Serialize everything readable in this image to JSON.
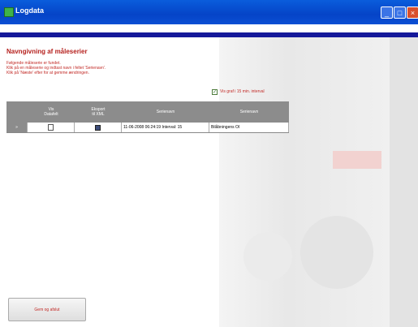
{
  "window": {
    "title": "Logdata"
  },
  "page": {
    "heading": "Navngivning af måleserier",
    "instructions": [
      "Følgende måleserie er fundet.",
      "Klik på en måleserie og indtast navn i feltet 'Serienavn'.",
      "Klik på 'Næste' efter for at gemme ændringen."
    ],
    "interval_checkbox": {
      "label": "Vis graf i 15 min. interval",
      "checked": true
    }
  },
  "grid": {
    "columns": [
      "Vis\nDatafelt",
      "Eksport\ntil XML",
      "Serienavn",
      "Serienavn"
    ],
    "rows": [
      {
        "row_marker": "»",
        "name": "11-06-2008 06:24:19 Interval: 15",
        "series": "Bilåbningens OI"
      }
    ]
  },
  "buttons": {
    "main": "Gem og afslut"
  }
}
